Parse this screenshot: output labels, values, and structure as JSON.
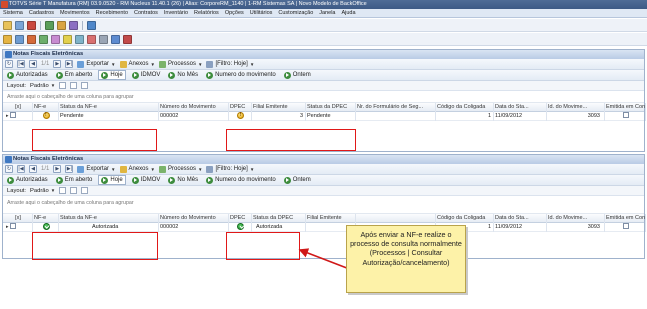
{
  "window": {
    "title": "TOTVS Série T Manufatura (RM) 03.9.0520 - RM Nucleus 11.40.1 (26) | Alias: CorporeRM_1140 | 1-RM Sistemas SA | Novo Modelo de BackOffice"
  },
  "menu": [
    "Sistema",
    "Cadastros",
    "Movimentos",
    "Recebimento",
    "Contratos",
    "Inventário",
    "Relatórios",
    "Opções",
    "Utilitários",
    "Customização",
    "Janela",
    "Ajuda"
  ],
  "panels": [
    {
      "title": "Notas Fiscais Eletrônicas",
      "page_counter": "1/1",
      "toolbar": {
        "exportar": "Exportar",
        "anexos": "Anexos",
        "processos": "Processos",
        "filtro": "[Filtro: Hoje]"
      },
      "tabs": [
        "Autorizadas",
        "Em aberto",
        "Hoje",
        "IDMOV",
        "No Mês",
        "Numero do movimento",
        "Ontem"
      ],
      "active_tab": "Hoje",
      "layout_label": "Layout:",
      "layout_value": "Padrão",
      "group_hint": "Arraste aqui o cabeçalho de uma coluna para agrupar",
      "columns": [
        "[x]",
        "NF-e",
        "Status da NF-e",
        "Número do Movimento",
        "DPEC",
        "Filial Emitente",
        "Status da DPEC",
        "Nr. do Formulário de Seg...",
        "Código da Coligada",
        "Data do Sta...",
        "Id. do Movime...",
        "Emitida em Conting..."
      ],
      "row": {
        "nfe_icon": "warning-icon",
        "status_nfe": "Pendente",
        "numero_movimento": "000002",
        "dpec_icon": "warning-icon",
        "filial": "3",
        "status_dpec": "Pendente",
        "formulario": "",
        "coligada": "1",
        "data_status": "11/09/2012",
        "id_movimento": "3093"
      }
    },
    {
      "title": "Notas Fiscais Eletrônicas",
      "page_counter": "1/1",
      "toolbar": {
        "exportar": "Exportar",
        "anexos": "Anexos",
        "processos": "Processos",
        "filtro": "[Filtro: Hoje]"
      },
      "tabs": [
        "Autorizadas",
        "Em aberto",
        "Hoje",
        "IDMOV",
        "No Mês",
        "Numero do movimento",
        "Ontem"
      ],
      "active_tab": "Hoje",
      "layout_label": "Layout:",
      "layout_value": "Padrão",
      "group_hint": "Arraste aqui o cabeçalho de uma coluna para agrupar",
      "columns": [
        "[x]",
        "NF-e",
        "Status da NF-e",
        "Número do Movimento",
        "DPEC",
        "Status da DPEC",
        "Filial Emitente",
        "",
        "Código da Coligada",
        "Data do Sta...",
        "Id. do Movime...",
        "Emitida em Conting..."
      ],
      "row": {
        "nfe_icon": "check-icon",
        "status_nfe": "Autorizada",
        "numero_movimento": "000002",
        "dpec_icon": "check-icon",
        "status_dpec": "Autorizada",
        "filial": "",
        "formulario": "",
        "coligada": "1",
        "data_status": "11/09/2012",
        "id_movimento": "3093"
      }
    }
  ],
  "annotation": {
    "text": "Após enviar a NF-e realize o processo de consulta normalmente (Processos | Consultar Autorização/cancelamento)",
    "box_color": "#fdf2a8",
    "highlight_color": "#e01818"
  },
  "colors": {
    "titlebar": "#3d5a85",
    "panel_header": "#b9cbe5",
    "status_ok": "#1f8a2c",
    "status_warn": "#e0a000"
  }
}
